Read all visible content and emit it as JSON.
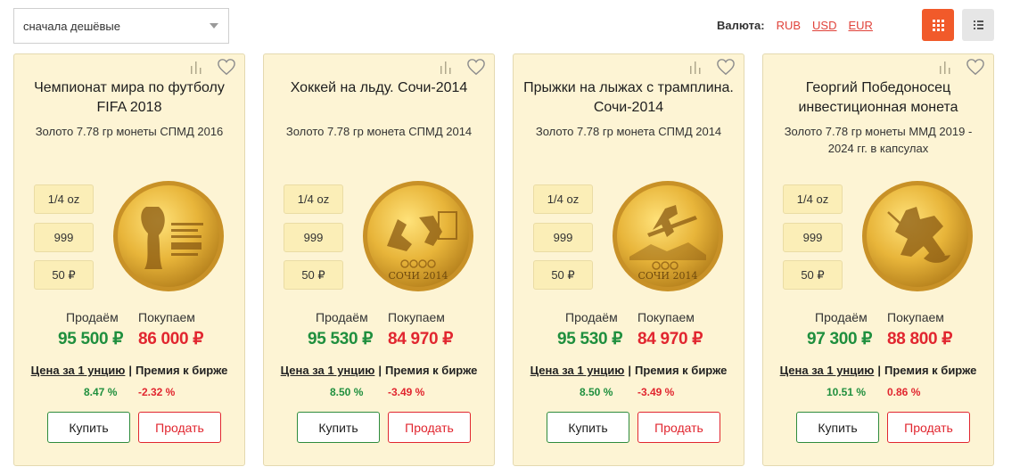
{
  "toolbar": {
    "sort_value": "сначала дешёвые",
    "currency_label": "Валюта:",
    "currencies": [
      "RUB",
      "USD",
      "EUR"
    ]
  },
  "colors": {
    "accent": "#f15a2a",
    "card_bg": "#fdf4d4",
    "sell_green": "#1f8f3e",
    "buy_red": "#e1262f"
  },
  "labels": {
    "sell": "Продаём",
    "buy": "Покупаем",
    "price_per_oz": "Цена за 1 унцию",
    "separator": "|",
    "premium": "Премия к бирже",
    "buy_button": "Купить",
    "sell_button": "Продать"
  },
  "cards": [
    {
      "title": "Чемпионат мира по футболу FIFA 2018",
      "desc": "Золото 7.78 гр монеты СПМД 2016",
      "weight": "1/4 oz",
      "purity": "999",
      "nominal": "50 ₽",
      "coin_icon": "fifa-cup-coin-icon",
      "sell_price": "95 500 ₽",
      "buy_price": "86 000 ₽",
      "pct_oz": "8.47 %",
      "pct_premium": "-2.32 %"
    },
    {
      "title": "Хоккей на льду. Сочи-2014",
      "desc": "Золото 7.78 гр монета СПМД 2014",
      "weight": "1/4 oz",
      "purity": "999",
      "nominal": "50 ₽",
      "coin_icon": "hockey-coin-icon",
      "coin_text": "СОЧИ 2014",
      "sell_price": "95 530 ₽",
      "buy_price": "84 970 ₽",
      "pct_oz": "8.50 %",
      "pct_premium": "-3.49 %"
    },
    {
      "title": "Прыжки на лыжах с трамплина. Сочи-2014",
      "desc": "Золото 7.78 гр монета СПМД 2014",
      "weight": "1/4 oz",
      "purity": "999",
      "nominal": "50 ₽",
      "coin_icon": "ski-jump-coin-icon",
      "coin_text": "СОЧИ 2014",
      "sell_price": "95 530 ₽",
      "buy_price": "84 970 ₽",
      "pct_oz": "8.50 %",
      "pct_premium": "-3.49 %"
    },
    {
      "title": "Георгий Победоносец инвестиционная монета",
      "desc": "Золото 7.78 гр монеты ММД 2019 - 2024 гг. в капсулах",
      "weight": "1/4 oz",
      "purity": "999",
      "nominal": "50 ₽",
      "coin_icon": "saint-george-coin-icon",
      "sell_price": "97 300 ₽",
      "buy_price": "88 800 ₽",
      "pct_oz": "10.51 %",
      "pct_premium": "0.86 %"
    }
  ]
}
